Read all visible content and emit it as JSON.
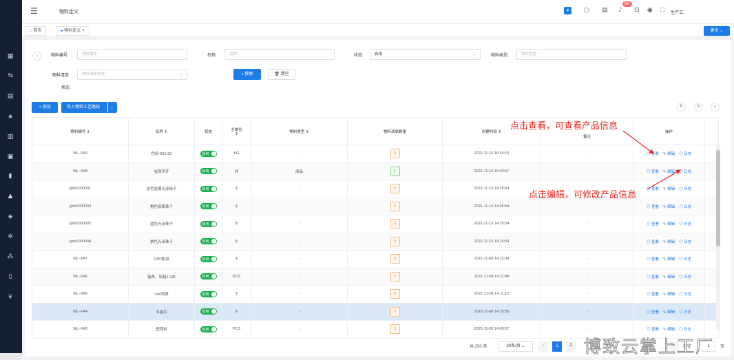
{
  "topbar": {
    "title": "物料定义",
    "badge": "99+",
    "user": "生产工."
  },
  "tabs": [
    {
      "label": "首页"
    },
    {
      "label": "物料定义"
    }
  ],
  "more_label": "更多",
  "filters": {
    "code_label": "物料编号:",
    "code_placeholder": "物料编号",
    "name_label": "名称:",
    "name_placeholder": "名称",
    "status_label": "状态:",
    "status_value": "启用",
    "type_label": "物料类型:",
    "type_placeholder": "物料类型",
    "bom_label": "物料清单",
    "bom_placeholder": "物料清单状态",
    "bom_label2": "状态:",
    "search_label": "搜索",
    "clear_label": "清空"
  },
  "toolbar": {
    "add_label": "添加",
    "import_label": "导入物料工艺路线"
  },
  "table": {
    "headers": [
      "物料编号",
      "名称",
      "状态",
      "主单位",
      "物料类型",
      "物料清单数量",
      "创建时间",
      "备注",
      "操作"
    ],
    "rows": [
      {
        "code": "WL--049",
        "name": "色粉-001-02",
        "status": "启用",
        "unit": "KG",
        "type": "-",
        "qty": "0",
        "time": "2021-11-16 16:45:13",
        "note": "-"
      },
      {
        "code": "WL--048",
        "name": "金珠手环",
        "status": "启用",
        "unit": "件",
        "type": "成品",
        "qty": "1",
        "time": "2021-11-16 16:40:57",
        "note": "-"
      },
      {
        "code": "glds0000001",
        "name": "金色金属光泽珠子",
        "status": "启用",
        "unit": "个",
        "type": "-",
        "qty": "0",
        "time": "2021-11-15 14:25:54",
        "note": "-"
      },
      {
        "code": "glds0000003",
        "name": "橙色搞眼珠子",
        "status": "启用",
        "unit": "个",
        "type": "-",
        "qty": "0",
        "time": "2021-11-15 14:25:54",
        "note": "-"
      },
      {
        "code": "glds0000002",
        "name": "蓝色光泽珠子",
        "status": "启用",
        "unit": "个",
        "type": "-",
        "qty": "0",
        "time": "2021-11-15 14:25:54",
        "note": "-"
      },
      {
        "code": "glds0000004",
        "name": "紫色光泽珠子",
        "status": "启用",
        "unit": "个",
        "type": "-",
        "qty": "0",
        "time": "2021-11-15 14:25:54",
        "note": "-"
      },
      {
        "code": "WL--047",
        "name": "OPP胶袋",
        "status": "启用",
        "unit": "个",
        "type": "-",
        "qty": "0",
        "time": "2021-11-08 14:12:09",
        "note": "-"
      },
      {
        "code": "WL--046",
        "name": "链条、铝链1.2米",
        "status": "启用",
        "unit": "PCS",
        "type": "-",
        "qty": "0",
        "time": "2021-11-08 14:11:48",
        "note": "-"
      },
      {
        "code": "WL--045",
        "name": "24#鸡眼",
        "status": "启用",
        "unit": "个",
        "type": "-",
        "qty": "0",
        "time": "2021-11-08 14:11:12",
        "note": "-"
      },
      {
        "code": "WL--044",
        "name": "五金扣",
        "status": "启用",
        "unit": "个",
        "type": "-",
        "qty": "0",
        "time": "2021-11-08 14:10:55",
        "note": "-"
      },
      {
        "code": "WL--043",
        "name": "塑壳料",
        "status": "启用",
        "unit": "PCS",
        "type": "-",
        "qty": "0",
        "time": "2021-11-08 14:09:57",
        "note": "-"
      }
    ],
    "ops": {
      "view": "查看",
      "edit": "编辑",
      "log": "日志"
    }
  },
  "annotations": {
    "view_hint": "点击查看，可查看产品信息",
    "edit_hint": "点击编辑，可修改产品信息"
  },
  "pager": {
    "total": "共 250 条",
    "size": "20条/页",
    "page1": "1",
    "page2": "2",
    "goto": "前往",
    "goto_val": "1",
    "page_suffix": "页"
  },
  "watermark": "博致云掌上工厂"
}
